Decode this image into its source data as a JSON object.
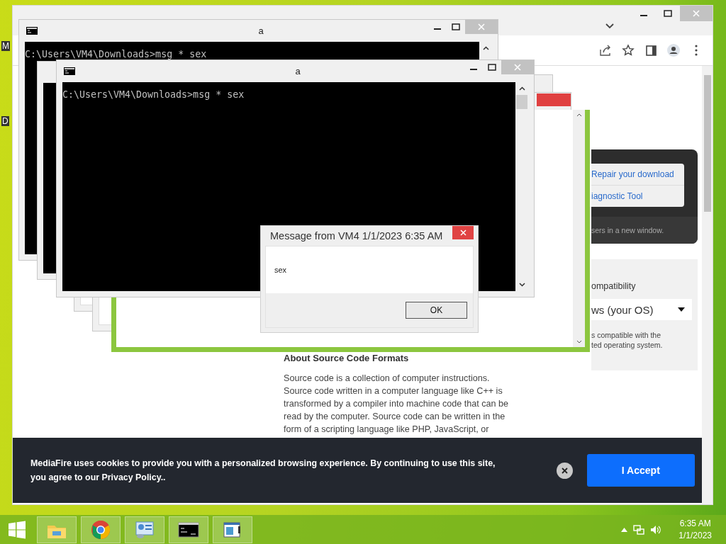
{
  "desktop": {
    "icon_labels": [
      "M",
      "D"
    ]
  },
  "browser": {
    "page": {
      "download_panel": {
        "links": [
          "Repair your download",
          "iagnostic Tool"
        ],
        "note": "sers in a new window."
      },
      "os_panel": {
        "heading": "ompatibility",
        "select_value": "ws (your OS)",
        "note_lines": [
          "s compatible with the",
          "ted operating system."
        ]
      },
      "article": {
        "heading": "About Source Code Formats",
        "paragraph": "Source code is a collection of computer instructions. Source code written in a computer language like C++ is transformed by a compiler into machine code that can be read by the computer. Source code can be written in the form of a scripting language like PHP, JavaScript, or"
      }
    },
    "cookie_banner": {
      "text": "MediaFire uses cookies to provide you with a personalized browsing experience. By continuing to use this site, you agree to our Privacy Policy..",
      "accept_button": "I Accept"
    }
  },
  "cmd_windows": [
    {
      "title": "a",
      "lines": [
        "C:\\Users\\VM4\\Downloads>msg * sex"
      ]
    },
    {
      "title": "a",
      "lines": [
        "C:\\Users\\VM4\\Downloads>msg * sex"
      ]
    }
  ],
  "message_box": {
    "title": "Message from VM4 1/1/2023 6:35 AM",
    "message": "sex",
    "button": "OK"
  },
  "taskbar": {
    "apps": [
      {
        "kind": "explorer"
      },
      {
        "kind": "chrome"
      },
      {
        "kind": "control-panel"
      },
      {
        "kind": "cmd"
      },
      {
        "kind": "window"
      }
    ],
    "time": "6:35 AM",
    "date": "1/1/2023"
  }
}
